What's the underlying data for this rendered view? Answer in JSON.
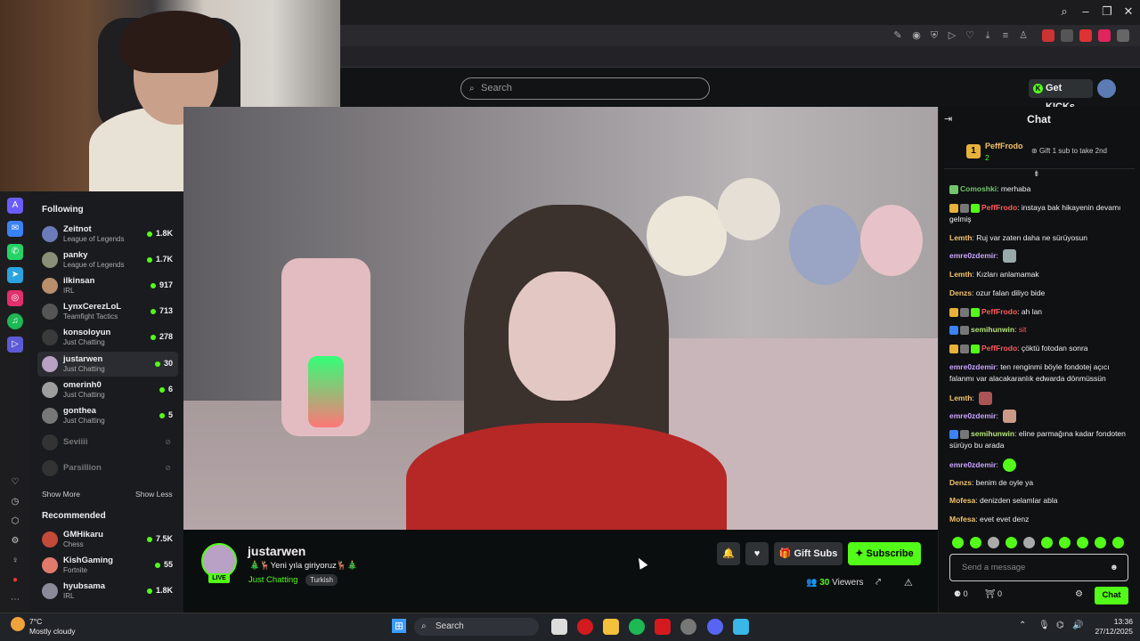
{
  "header": {
    "search_placeholder": "Search",
    "get_kicks": "Get KICKs"
  },
  "sidebar": {
    "following_title": "Following",
    "following": [
      {
        "name": "Zeitnot",
        "category": "League of Legends",
        "viewers": "1.8K",
        "color": "#6b7bb8"
      },
      {
        "name": "panky",
        "category": "League of Legends",
        "viewers": "1.7K",
        "color": "#8a8f77"
      },
      {
        "name": "ilkinsan",
        "category": "IRL",
        "viewers": "917",
        "color": "#b88e6b"
      },
      {
        "name": "LynxCerezLoL",
        "category": "Teamfight Tactics",
        "viewers": "713",
        "color": "#555"
      },
      {
        "name": "konsoloyun",
        "category": "Just Chatting",
        "viewers": "278",
        "color": "#3a3a3a"
      },
      {
        "name": "justarwen",
        "category": "Just Chatting",
        "viewers": "30",
        "color": "#b9a1c5"
      },
      {
        "name": "omerinh0",
        "category": "Just Chatting",
        "viewers": "6",
        "color": "#9e9e9e"
      },
      {
        "name": "gonthea",
        "category": "Just Chatting",
        "viewers": "5",
        "color": "#777"
      }
    ],
    "offline": [
      {
        "name": "Seviiii"
      },
      {
        "name": "Parsillion"
      }
    ],
    "show_more": "Show More",
    "show_less": "Show Less",
    "recommended_title": "Recommended",
    "recommended": [
      {
        "name": "GMHikaru",
        "category": "Chess",
        "viewers": "7.5K",
        "color": "#c24a3a"
      },
      {
        "name": "KishGaming",
        "category": "Fortnite",
        "viewers": "55",
        "color": "#e07a6b"
      },
      {
        "name": "hyubsama",
        "category": "IRL",
        "viewers": "1.8K",
        "color": "#8a8a9a"
      }
    ]
  },
  "stream": {
    "streamer": "justarwen",
    "live": "LIVE",
    "title": "🎄🦌Yeni yıla giriyoruz🦌🎄",
    "category": "Just Chatting",
    "tag": "Turkish",
    "viewers_count": "30",
    "viewers_label": "Viewers",
    "gift_subs": "Gift Subs",
    "subscribe": "Subscribe"
  },
  "chat": {
    "title": "Chat",
    "pinned": {
      "user": "PeffFrodo",
      "rank": "1",
      "count": "2",
      "gift_prompt": "Gift 1 sub to take 2nd"
    },
    "messages": [
      {
        "user": "Comoshki",
        "color": "#71c66a",
        "text": "merhaba"
      },
      {
        "user": "PeffFrodo",
        "color": "#ff5a5a",
        "text": "instaya bak hikayenin devamı gelmiş"
      },
      {
        "user": "Lemth",
        "color": "#f4c26a",
        "text": "Ruj var zaten daha ne sürüyosun"
      },
      {
        "user": "emre0zdemir",
        "color": "#c9a5ff",
        "text": ""
      },
      {
        "user": "Lemth",
        "color": "#f4c26a",
        "text": "Kızları anlamamak"
      },
      {
        "user": "Denzs",
        "color": "#f4c26a",
        "text": "ozur falan diliyo bide"
      },
      {
        "user": "PeffFrodo",
        "color": "#ff5a5a",
        "text": "ah lan"
      },
      {
        "user": "semihunwin",
        "color": "#b6e37a",
        "text": "sit"
      },
      {
        "user": "PeffFrodo",
        "color": "#ff5a5a",
        "text": "çöktü fotodan sonra"
      },
      {
        "user": "emre0zdemir",
        "color": "#c9a5ff",
        "text": "ten renginmi böyle fondoteį açıcı falanmı var alacakaranlık edwarda dönmüssün"
      },
      {
        "user": "Lemth",
        "color": "#f4c26a",
        "text": ""
      },
      {
        "user": "emre0zdemir",
        "color": "#c9a5ff",
        "text": ""
      },
      {
        "user": "semihunwin",
        "color": "#b6e37a",
        "text": "eline parmağına kadar fondoten sürüyo bu arada"
      },
      {
        "user": "emre0zdemir",
        "color": "#c9a5ff",
        "text": ""
      },
      {
        "user": "Denzs",
        "color": "#f4c26a",
        "text": "benim de oyle ya"
      },
      {
        "user": "Mofesa",
        "color": "#f4c26a",
        "text": "denizden selamlar abla"
      },
      {
        "user": "Mofesa",
        "color": "#f4c26a",
        "text": "evet evet denz"
      }
    ],
    "input_placeholder": "Send a message",
    "kicks_count": "0",
    "gifts_count": "0",
    "send": "Chat"
  },
  "taskbar": {
    "temperature": "7°C",
    "weather": "Mostly cloudy",
    "search": "Search",
    "time": "13:36",
    "date": "27/12/2025"
  }
}
